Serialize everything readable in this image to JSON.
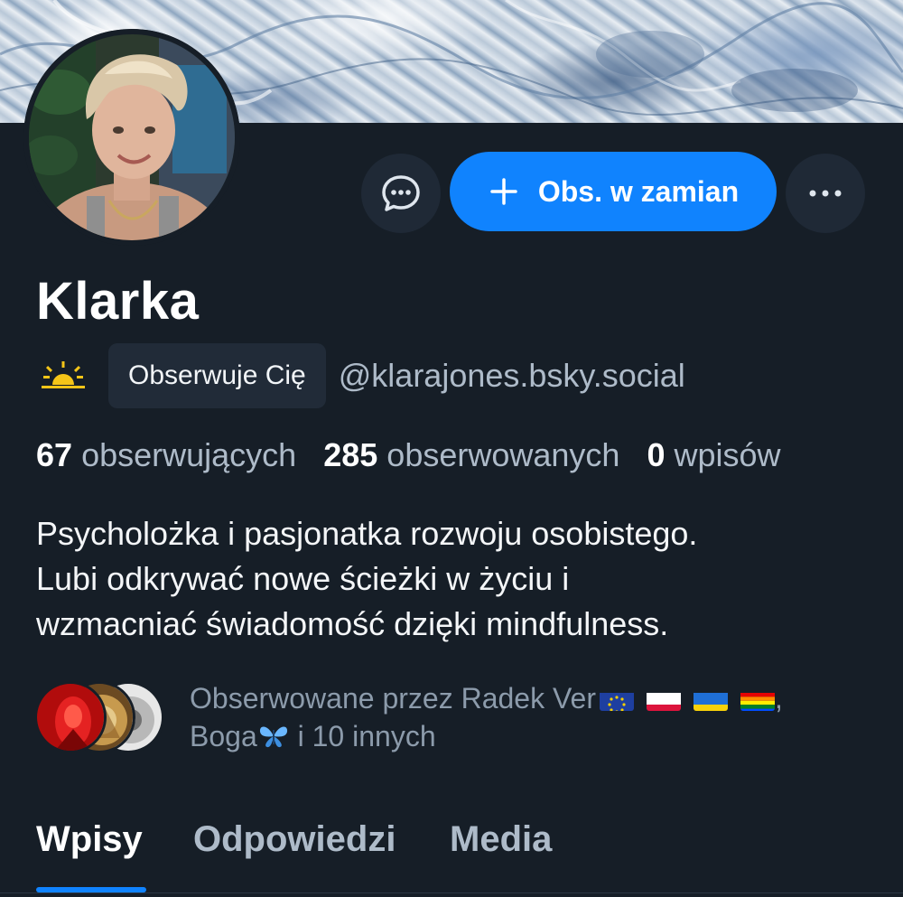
{
  "profile": {
    "display_name": "Klarka",
    "handle": "@klarajones.bsky.social",
    "follows_you_label": "Obserwuje Cię",
    "status_icon": "sun-icon"
  },
  "actions": {
    "message_icon": "chat-bubble-icon",
    "follow_back_label": "Obs. w zamian",
    "follow_icon": "plus-icon",
    "more_icon": "ellipsis-icon"
  },
  "stats": {
    "followers_count": "67",
    "followers_label": "obserwujących",
    "following_count": "285",
    "following_label": "obserwowanych",
    "posts_count": "0",
    "posts_label": "wpisów"
  },
  "bio": {
    "lines": [
      "Psycholożka i pasjonatka rozwoju osobistego.",
      "Lubi odkrywać nowe ścieżki w życiu i",
      "wzmacniać świadomość dzięki mindfulness."
    ]
  },
  "followed_by": {
    "line1_prefix": "Obserwowane przez Radek Ver",
    "flags": [
      "eu-flag",
      "poland-flag",
      "ukraine-flag",
      "rainbow-flag"
    ],
    "line1_suffix": ",",
    "line2_name": "Boga",
    "line2_emoji": "butterfly-icon",
    "line2_rest": " i 10 innych"
  },
  "tabs": [
    {
      "label": "Wpisy",
      "active": true
    },
    {
      "label": "Odpowiedzi",
      "active": false
    },
    {
      "label": "Media",
      "active": false
    }
  ],
  "colors": {
    "background": "#161e27",
    "accent": "#1083fe",
    "muted_text": "#aebbc9",
    "pill_bg": "#212b38"
  }
}
